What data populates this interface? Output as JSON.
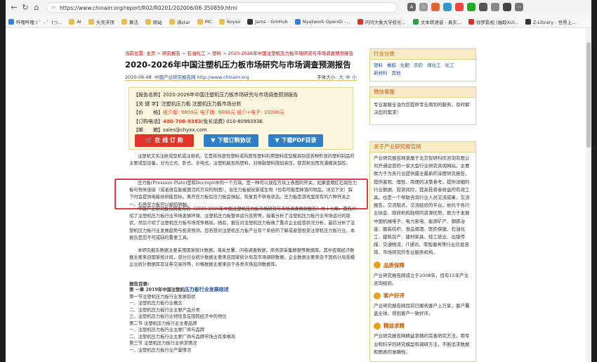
{
  "browser": {
    "url": "https://www.chinairr.org/report/R02/R0201/202006/08-350859.html",
    "bookmarks": [
      "哔哩哔哩 ( ゜- ゜)つ...",
      "AI",
      "头壳浮顶",
      "算法",
      "网站",
      "沸star",
      "MC",
      "Koyso",
      "Jams - GmHub",
      "Nyatwork OpenID -...",
      "问问大象大学校长...",
      "文本转语音 - 真实...",
      "你罗影视 (抽取XLY...",
      "Z-Library - 世界上..."
    ]
  },
  "breadcrumb": [
    "当前位置: 主页",
    "研究报告",
    "石油化工",
    "塑料",
    "2020-2026年中国注塑机压力板市场研究与市场调查预测报告"
  ],
  "title": "2020-2026年中国注塑机压力板市场研究与市场调查预测报告",
  "meta": {
    "date": "2020-06-08",
    "source": "中国产业研究报告网 http://www.chinairr.org",
    "fontsize_label": "字体大小:",
    "sizes": [
      "大",
      "中",
      "小"
    ]
  },
  "info": {
    "report_name_label": "【报告名称】",
    "report_name": "2020-2026年中国注塑机压力板市场研究与市场调查预测报告",
    "keywords_label": "【关 键 字】",
    "keywords": "注塑机压力板 注塑机压力板市场分析",
    "price_label": "【价　　格】",
    "price": "纸介版: 9800元  电子版: 9800元  纸介+电子: 10000元",
    "phone_label": "【订购电话】",
    "phone_hot": "400-700-9383",
    "phone_rest": "(免长话费) 010-80993936",
    "email_label": "【邮　　箱】",
    "email": "sales@chyxx.com"
  },
  "buttons": {
    "buy": "在 线 订 购",
    "protocol": "下载订购协议",
    "pdf": "下载PDF目录"
  },
  "paragraphs": {
    "p1": "注塑机又名注射成型机或注射机。它是将热塑性塑料或热固性塑料利用塑料成型模具制成各种形状的塑料制品的主要成型设备，分为立式、卧式、全电式。注塑机能加热塑料，对熔融塑料施加高压，使其射出而充满模具型腔。",
    "p2": "压力板(Pressure Plate)是和Decrepit中的一个方块。是一种可以放在方块上表面的开关。如果使用红石将压力板与物体连接（或者放在能被激活的方块的侧面），当压力板被玩家或生物（也有可能是掉落的物品，详见下文）踩下时会提供电能给供能目标。离开压力板后压力板会弹起，恢复到不供电状态。压力板是游戏里现有的六种开关之一，石质压力板可以被陷阱触。",
    "p3": "中国产业研究报告网发布的《2020-2026年中国注塑机压力板市场研究与市场调查预测报告》共十七章。首先介绍了注塑机压力板行业市场发展环境、注塑机压力板整体运行态势等，接着分析了注塑机压力板行业市场运行的现状，然后介绍了注塑机压力板市场竞争格局。随后，报告对注塑机压力板做了重点企业经营状况分析，最后分析了注塑机压力板行业发展趋势与投资预测。您若想对注塑机压力板产业有个系统的了解或者想投资注塑机压力板行业，本报告是您不可或缺的重要工具。",
    "p4": "本研究报告数据主要采用国家统计数据，海关总署，问卷调查数据，商务部采集数据等数据库。其中宏观经济数据主要来自国家统计局，部分行业统计数据主要来自国家统计局及市场调研数据，企业数据主要来自于国统计局规模企业统计数据库及证券交易所等，价格数据主要来自于各类市场监测数据库。"
  },
  "toc": {
    "title": "报告目录:",
    "chapter_prefix": "第 一章 2019年中国注塑机",
    "chapter_highlight": "压力板行业发展综述",
    "items": [
      "第一节注塑机压力板行业发展现状",
      "一、注塑机压力板行业概念",
      "二、注塑机压力板行业主要产品分类",
      "三、注塑机压力板行业特性及在国民经济中的地位",
      "第二节 注塑机压力板行业主要品牌",
      "一、注塑机压力板行业主要厂商与品牌",
      "二、注塑机压力板行业主要厂商与品牌市场占有率格局",
      "第三节 注塑机压力板行业供求情况",
      "一、注塑机压力板行业产量情况"
    ]
  },
  "sidebar": {
    "category_title": "行业分类",
    "categories": [
      "塑料",
      "橡胶",
      "化肥",
      "农药",
      "煤化工",
      "化工",
      "新材料",
      "其他"
    ],
    "service_title": "微信客服",
    "service_text": "专业客服全油为您提供专业周到的服务，及时解决您的需求！",
    "about_title": "关于产业研究报告网",
    "about_text": "产业研究报告网隶属于北京智研科信咨询有限公司开通运营的一家大型行业研究咨询网站，主要致力于为各行业提供最全最新的深度研究报告，提供客观、理性、简便的决策参考，提供详细的行业数据、投资风险，提高投资者收益的有效工具。也是一个帮助咨询行业人员交流成果，交流报告，交流观点，交流经验的平台。依托于各行业协会、政府机构独特的资源优势，致力于发展中国机械电子、电力家电、能源矿产、钢铁冶金、服装纺织、食品烟酒、医药保健、石油化工、建筑房产、建材家具、轻工纸业、出版传媒、交通物流、IT通讯、零售服务等行业信息咨询、市场研究的专业服务机构。",
    "features": [
      {
        "title": "品质保障",
        "text": "产业研究报告网成立于2008年，目有15年产业咨询经验。"
      },
      {
        "title": "客户好评",
        "text": "产业研究报告网目前已服务客户上万家，客户覆盖全球，得到客户一致好评。"
      },
      {
        "title": "精益求精",
        "text": "产业研究报告网精益求精的完善研究方法，用专业和科学的研究模型和调研方法，不断追求数据和图表的准确性。"
      }
    ]
  },
  "colors": {
    "accent_red": "#e03c4b",
    "link_blue": "#1a4fa0",
    "side_header": "#c45a00"
  }
}
